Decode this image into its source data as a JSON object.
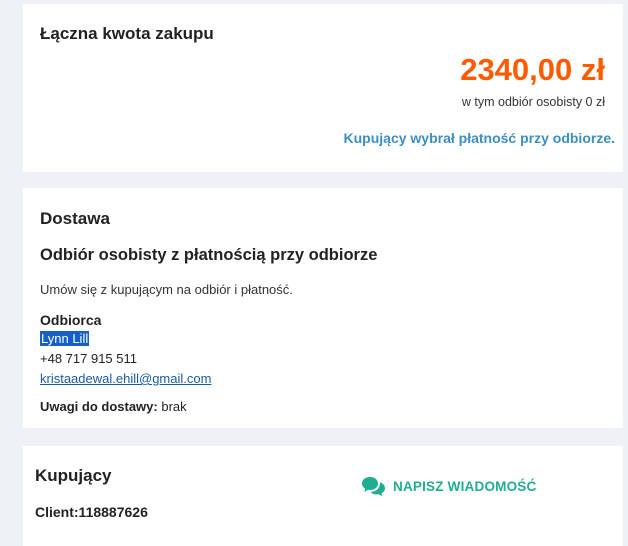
{
  "total": {
    "title": "Łączna kwota zakupu",
    "amount": "2340,00 zł",
    "pickup_note": "w tym odbiór osobisty 0 zł",
    "payment_info": "Kupujący wybrał płatność przy odbiorze."
  },
  "delivery": {
    "title": "Dostawa",
    "method": "Odbiór osobisty z płatnością przy odbiorze",
    "arrange_text": "Umów się z kupującym na odbiór i płatność.",
    "recipient_label": "Odbiorca",
    "recipient_name": "Lynn Lill",
    "recipient_phone": "+48 717 915 511",
    "recipient_email": "kristaadewal.ehill@gmail.com",
    "notes_label": "Uwagi do dostawy:",
    "notes_value": "brak"
  },
  "buyer": {
    "title": "Kupujący",
    "client_id": "Client:118887626",
    "message_button": "NAPISZ WIADOMOŚĆ",
    "message_icon": "chat-bubbles-icon"
  },
  "colors": {
    "amount": "#ff5a00",
    "payment_info": "#3a8fc6",
    "message_button": "#1fae8f",
    "selection": "#1560c8"
  }
}
